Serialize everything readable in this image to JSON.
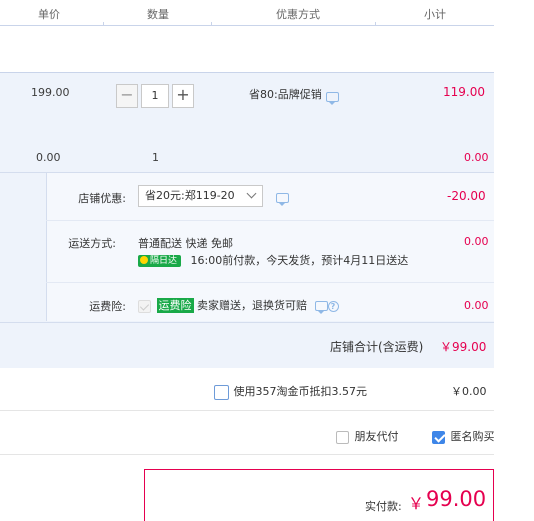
{
  "header": {
    "unit_price": "单价",
    "quantity": "数量",
    "discount": "优惠方式",
    "subtotal": "小计"
  },
  "item1": {
    "unit_price": "199.00",
    "quantity": "1",
    "minus": "−",
    "plus": "+",
    "discount": "省80:品牌促销",
    "subtotal": "119.00"
  },
  "item2": {
    "unit_price": "0.00",
    "quantity": "1",
    "subtotal": "0.00"
  },
  "shop": {
    "coupon_label": "店铺优惠:",
    "coupon_value": "省20元:郑119-20",
    "coupon_amount": "-20.00",
    "shipping_label": "运送方式:",
    "shipping_method": "普通配送 快递 免邮",
    "shipping_badge": "隔日达",
    "shipping_note": "16:00前付款，今天发货，预计4月11日送达",
    "shipping_amount": "0.00",
    "insurance_label": "运费险:",
    "insurance_badge": "运费险",
    "insurance_note": "卖家赠送，退换货可赔",
    "insurance_amount": "0.00",
    "total_label": "店铺合计(含运费)",
    "total_value": "￥99.00"
  },
  "coins": {
    "label": "使用357淘金币抵扣3.57元",
    "value": "￥0.00"
  },
  "options": {
    "friend_pay": "朋友代付",
    "anonymous": "匿名购买"
  },
  "pay": {
    "label": "实付款:",
    "currency": "￥",
    "amount": "99.00"
  },
  "colors": {
    "accent_red": "#e5004f",
    "check_blue": "#3e86e8",
    "green_badge": "#19a948"
  }
}
